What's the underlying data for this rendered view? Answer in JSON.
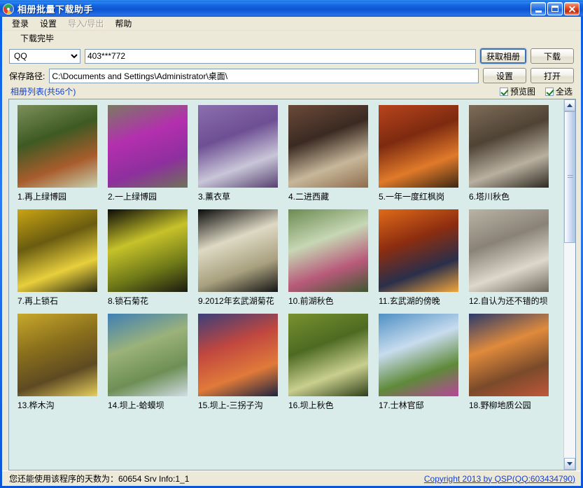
{
  "window": {
    "title": "相册批量下载助手",
    "icon": "photo-album-icon",
    "minimize_label": "最小化",
    "maximize_label": "最大化",
    "close_label": "关闭"
  },
  "menubar": {
    "items": [
      {
        "label": "登录",
        "disabled": false
      },
      {
        "label": "设置",
        "disabled": false
      },
      {
        "label": "导入/导出",
        "disabled": true
      },
      {
        "label": "帮助",
        "disabled": false
      }
    ]
  },
  "progress_status": {
    "text": "下载完毕"
  },
  "toolbar": {
    "account_type": "QQ",
    "account_type_options": [
      "QQ"
    ],
    "account_value": "403***772",
    "account_placeholder": "",
    "fetch_album_label": "获取相册",
    "download_label": "下载",
    "save_path_label": "保存路径:",
    "save_path_value": "C:\\Documents and Settings\\Administrator\\桌面\\",
    "settings_label": "设置",
    "open_label": "打开"
  },
  "album_list": {
    "caption": "相册列表(共56个)",
    "preview_label": "预览图",
    "preview_checked": true,
    "select_all_label": "全选",
    "select_all_checked": true,
    "items": [
      {
        "caption": "1.再上绿博园",
        "colors": [
          "#7d8f5a",
          "#3e5a23",
          "#a85c2c",
          "#c8d2b0"
        ]
      },
      {
        "caption": "2.一上绿博园",
        "colors": [
          "#7b7a63",
          "#b32fae",
          "#8e2f9e",
          "#6e7358"
        ]
      },
      {
        "caption": "3.薰衣草",
        "colors": [
          "#8b6fae",
          "#6d4f93",
          "#c9c6d8",
          "#56406f"
        ]
      },
      {
        "caption": "4.二进西藏",
        "colors": [
          "#6b4a39",
          "#3a2a22",
          "#c7b79a",
          "#8e6c4c"
        ]
      },
      {
        "caption": "5.一年一度红枫岗",
        "colors": [
          "#b8441c",
          "#7d2a10",
          "#e07a2a",
          "#3c2612"
        ]
      },
      {
        "caption": "6.塔川秋色",
        "colors": [
          "#7e6c57",
          "#4f4336",
          "#b9b0a0",
          "#2e2820"
        ]
      },
      {
        "caption": "7.再上锁石",
        "colors": [
          "#c9a413",
          "#6a5c10",
          "#e8cf3c",
          "#2a2a12"
        ]
      },
      {
        "caption": "8.锁石菊花",
        "colors": [
          "#0b0b08",
          "#c7c22a",
          "#6f7a18",
          "#1a1a10"
        ]
      },
      {
        "caption": "9.2012年玄武湖菊花",
        "colors": [
          "#0a0a0a",
          "#ded9c4",
          "#a8a07e",
          "#141414"
        ]
      },
      {
        "caption": "10.前湖秋色",
        "colors": [
          "#6d8a52",
          "#c6d7b4",
          "#b85a7a",
          "#3f5730"
        ]
      },
      {
        "caption": "11.玄武湖的傍晚",
        "colors": [
          "#e06a18",
          "#8c2d10",
          "#2a2f4a",
          "#f0a63c"
        ]
      },
      {
        "caption": "12.自认为还不错的坝",
        "colors": [
          "#b9b3a6",
          "#8a8276",
          "#ddd8cc",
          "#6e675c"
        ]
      },
      {
        "caption": "13.桦木沟",
        "colors": [
          "#c8a82c",
          "#8a6f1c",
          "#5e4a22",
          "#e6cf5e"
        ]
      },
      {
        "caption": "14.坝上-蛤蟆坝",
        "colors": [
          "#3f7fb5",
          "#9bb27a",
          "#6d8f55",
          "#d2dce6"
        ]
      },
      {
        "caption": "15.坝上-三拐子沟",
        "colors": [
          "#3a3f7a",
          "#c1473f",
          "#e07a3a",
          "#1e2340"
        ]
      },
      {
        "caption": "16.坝上秋色",
        "colors": [
          "#78912f",
          "#4d6a22",
          "#c9cf8e",
          "#2f3f18"
        ]
      },
      {
        "caption": "17.士林官邸",
        "colors": [
          "#4e8fc4",
          "#c8dcee",
          "#5f8a3a",
          "#b8459a"
        ]
      },
      {
        "caption": "18.野柳地质公园",
        "colors": [
          "#2b3a6a",
          "#e08a3c",
          "#7a4a2a",
          "#c0573a"
        ]
      }
    ]
  },
  "scrollbar": {
    "up_label": "向上滚动",
    "down_label": "向下滚动"
  },
  "statusbar": {
    "days_text": "您还能使用该程序的天数为：60654  Srv Info:1_1",
    "copyright": "Copyright 2013 by QSP(QQ:603434790)"
  }
}
